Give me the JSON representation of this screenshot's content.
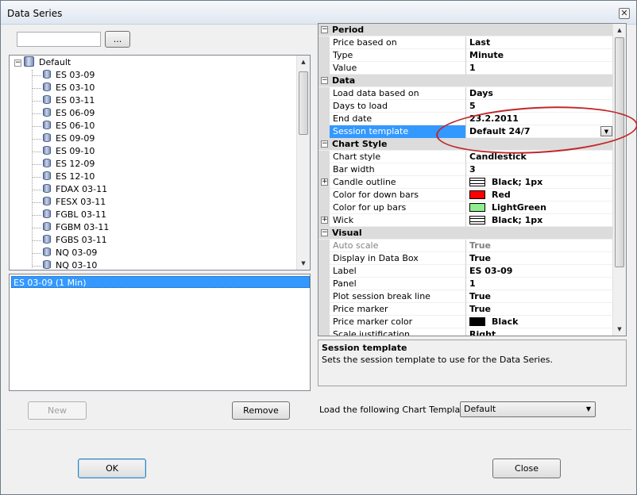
{
  "window": {
    "title": "Data Series"
  },
  "search": {
    "value": "",
    "browse_label": "..."
  },
  "tree": {
    "root": "Default",
    "items": [
      "ES 03-09",
      "ES 03-10",
      "ES 03-11",
      "ES 06-09",
      "ES 06-10",
      "ES 09-09",
      "ES 09-10",
      "ES 12-09",
      "ES 12-10",
      "FDAX 03-11",
      "FESX 03-11",
      "FGBL 03-11",
      "FGBM 03-11",
      "FGBS 03-11",
      "NQ 03-09",
      "NQ 03-10"
    ]
  },
  "selected_list": {
    "items": [
      "ES 03-09 (1 Min)"
    ]
  },
  "buttons": {
    "new": "New",
    "remove": "Remove",
    "ok": "OK",
    "close": "Close"
  },
  "properties": {
    "period": {
      "label": "Period",
      "price_based_on": {
        "name": "Price based on",
        "value": "Last"
      },
      "type": {
        "name": "Type",
        "value": "Minute"
      },
      "value": {
        "name": "Value",
        "value": "1"
      }
    },
    "data": {
      "label": "Data",
      "load_based_on": {
        "name": "Load data based on",
        "value": "Days"
      },
      "days_to_load": {
        "name": "Days to load",
        "value": "5"
      },
      "end_date": {
        "name": "End date",
        "value": "23.2.2011"
      },
      "session_template": {
        "name": "Session template",
        "value": "Default 24/7"
      }
    },
    "chart_style": {
      "label": "Chart Style",
      "chart_style": {
        "name": "Chart style",
        "value": "Candlestick"
      },
      "bar_width": {
        "name": "Bar width",
        "value": "3"
      },
      "candle_outline": {
        "name": "Candle outline",
        "value": "Black; 1px"
      },
      "down_bars": {
        "name": "Color for down bars",
        "value": "Red",
        "color": "#ff0000"
      },
      "up_bars": {
        "name": "Color for up bars",
        "value": "LightGreen",
        "color": "#90ee90"
      },
      "wick": {
        "name": "Wick",
        "value": "Black; 1px"
      }
    },
    "visual": {
      "label": "Visual",
      "auto_scale": {
        "name": "Auto scale",
        "value": "True"
      },
      "display_in_data_box": {
        "name": "Display in Data Box",
        "value": "True"
      },
      "label_prop": {
        "name": "Label",
        "value": "ES 03-09"
      },
      "panel": {
        "name": "Panel",
        "value": "1"
      },
      "session_break": {
        "name": "Plot session break line",
        "value": "True"
      },
      "price_marker": {
        "name": "Price marker",
        "value": "True"
      },
      "price_marker_color": {
        "name": "Price marker color",
        "value": "Black",
        "color": "#000000"
      },
      "scale_justification": {
        "name": "Scale justification",
        "value": "Right"
      }
    }
  },
  "description": {
    "title": "Session template",
    "text": "Sets the session template to use for the Data Series."
  },
  "chart_template": {
    "label": "Load the following Chart Template:",
    "value": "Default"
  },
  "colors": {
    "selection": "#3399ff",
    "annotation": "#c0282a"
  }
}
